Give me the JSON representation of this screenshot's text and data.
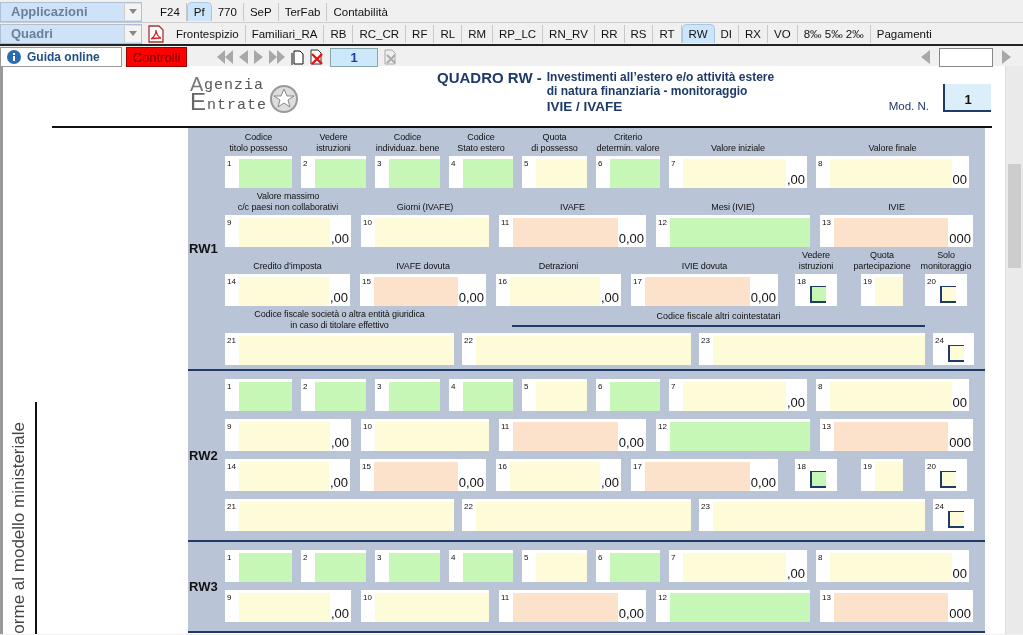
{
  "app_menu": {
    "label": "Applicazioni"
  },
  "app_tabs": [
    {
      "label": "F24",
      "selected": false
    },
    {
      "label": "Pf",
      "selected": true
    },
    {
      "label": "770",
      "selected": false
    },
    {
      "label": "SeP",
      "selected": false
    },
    {
      "label": "TerFab",
      "selected": false
    },
    {
      "label": "Contabilità",
      "selected": false
    }
  ],
  "section_menu": {
    "label": "Quadri"
  },
  "section_tabs": [
    {
      "label": "Frontespizio",
      "selected": false
    },
    {
      "label": "Familiari_RA",
      "selected": false
    },
    {
      "label": "RB",
      "selected": false
    },
    {
      "label": "RC_CR",
      "selected": false
    },
    {
      "label": "RF",
      "selected": false
    },
    {
      "label": "RL",
      "selected": false
    },
    {
      "label": "RM",
      "selected": false
    },
    {
      "label": "RP_LC",
      "selected": false
    },
    {
      "label": "RN_RV",
      "selected": false
    },
    {
      "label": "RR",
      "selected": false
    },
    {
      "label": "RS",
      "selected": false
    },
    {
      "label": "RT",
      "selected": false
    },
    {
      "label": "RW",
      "selected": true
    },
    {
      "label": "DI",
      "selected": false
    },
    {
      "label": "RX",
      "selected": false
    },
    {
      "label": "VO",
      "selected": false
    },
    {
      "label": "8‰ 5‰ 2‰",
      "selected": false
    },
    {
      "label": "Pagamenti",
      "selected": false
    }
  ],
  "toolbar": {
    "help_button": "Guida online",
    "checks_button": "Controlli",
    "page_field": "1"
  },
  "side_note": "orme al modello ministeriale",
  "header": {
    "logo": {
      "initial_top": "A",
      "text_top": "genzia",
      "initial_bottom": "E",
      "text_bottom": "ntrate"
    },
    "title": "QUADRO RW -",
    "subtitle_lines": [
      "Investimenti all’estero e/o attività estere",
      "di natura finanziaria - monitoraggio",
      "IVIE / IVAFE"
    ],
    "mod_label": "Mod. N.",
    "mod_value": "1"
  },
  "sections": [
    {
      "label": "RW1",
      "rows": [
        {
          "kind": "codes",
          "fields": [
            {
              "number": "1",
              "label": "Codice\ntitolo possesso",
              "kind": "input",
              "color": "#c6f7b6"
            },
            {
              "number": "2",
              "label": "Vedere\nistruzioni",
              "kind": "input",
              "color": "#c6f7b6"
            },
            {
              "number": "3",
              "label": "Codice\nindividuaz. bene",
              "kind": "input",
              "color": "#c6f7b6"
            },
            {
              "number": "4",
              "label": "Codice\nStato estero",
              "kind": "input",
              "color": "#c6f7b6"
            },
            {
              "number": "5",
              "label": "Quota\ndi possesso",
              "kind": "input",
              "color": "#fefbd9"
            },
            {
              "number": "6",
              "label": "Criterio\ndetermin. valore",
              "kind": "input",
              "color": "#c6f7b6"
            },
            {
              "number": "7",
              "label": "Valore iniziale",
              "kind": "input",
              "color": "#fefbd9",
              "suffix": ",00"
            },
            {
              "number": "8",
              "label": "Valore finale",
              "kind": "input",
              "color": "#fefbd9",
              "suffix": "00"
            }
          ]
        },
        {
          "kind": "values",
          "fields": [
            {
              "number": "9",
              "label": "Valore massimo\nc/c paesi non collaborativi",
              "kind": "input",
              "color": "#fefbd9",
              "suffix": ",00"
            },
            {
              "number": "10",
              "label": "Giorni (IVAFE)",
              "kind": "input",
              "color": "#fefbd9"
            },
            {
              "number": "11",
              "label": "IVAFE",
              "kind": "input",
              "color": "#fde2cb",
              "suffix": "0,00"
            },
            {
              "number": "12",
              "label": "Mesi (IVIE)",
              "kind": "input",
              "color": "#c6f7b6"
            },
            {
              "number": "13",
              "label": "IVIE",
              "kind": "input",
              "color": "#fde2cb",
              "suffix": "000"
            }
          ]
        },
        {
          "kind": "credits",
          "fields": [
            {
              "number": "14",
              "label": "Credito d’imposta",
              "kind": "input",
              "color": "#fefbd9",
              "suffix": ",00"
            },
            {
              "number": "15",
              "label": "IVAFE dovuta",
              "kind": "input",
              "color": "#fde2cb",
              "suffix": "0,00"
            },
            {
              "number": "16",
              "label": "Detrazioni",
              "kind": "input",
              "color": "#fefbd9",
              "suffix": ",00"
            },
            {
              "number": "17",
              "label": "IVIE dovuta",
              "kind": "input",
              "color": "#fde2cb",
              "suffix": "0,00"
            },
            {
              "number": "18",
              "label": "Vedere\nistruzioni",
              "kind": "check",
              "color": "#c6f7b6",
              "checked": false
            },
            {
              "number": "19",
              "label": "Quota\npartecipazione",
              "kind": "input",
              "color": "#fefbd9"
            },
            {
              "number": "20",
              "label": "Solo\nmonitoraggio",
              "kind": "check",
              "color": "#fefbd9",
              "checked": false
            }
          ]
        },
        {
          "kind": "fiscal",
          "group_heading": "Codice fiscale altri cointestatari",
          "fields": [
            {
              "number": "21",
              "label": "Codice fiscale società o altra entità giuridica\nin caso di titolare effettivo",
              "kind": "input",
              "color": "#fefbd9"
            },
            {
              "number": "22",
              "kind": "input",
              "color": "#fefbd9"
            },
            {
              "number": "23",
              "kind": "input",
              "color": "#fefbd9"
            },
            {
              "number": "24",
              "kind": "check",
              "color": "#fefbd9",
              "checked": false
            }
          ]
        }
      ]
    },
    {
      "label": "RW2",
      "rows": [
        {
          "kind": "codes",
          "fields": [
            {
              "number": "1",
              "kind": "input",
              "color": "#c6f7b6"
            },
            {
              "number": "2",
              "kind": "input",
              "color": "#c6f7b6"
            },
            {
              "number": "3",
              "kind": "input",
              "color": "#c6f7b6"
            },
            {
              "number": "4",
              "kind": "input",
              "color": "#c6f7b6"
            },
            {
              "number": "5",
              "kind": "input",
              "color": "#fefbd9"
            },
            {
              "number": "6",
              "kind": "input",
              "color": "#c6f7b6"
            },
            {
              "number": "7",
              "kind": "input",
              "color": "#fefbd9",
              "suffix": ",00"
            },
            {
              "number": "8",
              "kind": "input",
              "color": "#fefbd9",
              "suffix": "00"
            }
          ]
        },
        {
          "kind": "values",
          "fields": [
            {
              "number": "9",
              "kind": "input",
              "color": "#fefbd9",
              "suffix": ",00"
            },
            {
              "number": "10",
              "kind": "input",
              "color": "#fefbd9"
            },
            {
              "number": "11",
              "kind": "input",
              "color": "#fde2cb",
              "suffix": "0,00"
            },
            {
              "number": "12",
              "kind": "input",
              "color": "#c6f7b6"
            },
            {
              "number": "13",
              "kind": "input",
              "color": "#fde2cb",
              "suffix": "000"
            }
          ]
        },
        {
          "kind": "credits",
          "fields": [
            {
              "number": "14",
              "kind": "input",
              "color": "#fefbd9",
              "suffix": ",00"
            },
            {
              "number": "15",
              "kind": "input",
              "color": "#fde2cb",
              "suffix": "0,00"
            },
            {
              "number": "16",
              "kind": "input",
              "color": "#fefbd9",
              "suffix": ",00"
            },
            {
              "number": "17",
              "kind": "input",
              "color": "#fde2cb",
              "suffix": "0,00"
            },
            {
              "number": "18",
              "kind": "check",
              "color": "#c6f7b6",
              "checked": false
            },
            {
              "number": "19",
              "kind": "input",
              "color": "#fefbd9"
            },
            {
              "number": "20",
              "kind": "check",
              "color": "#fefbd9",
              "checked": false
            }
          ]
        },
        {
          "kind": "fiscal",
          "fields": [
            {
              "number": "21",
              "kind": "input",
              "color": "#fefbd9"
            },
            {
              "number": "22",
              "kind": "input",
              "color": "#fefbd9"
            },
            {
              "number": "23",
              "kind": "input",
              "color": "#fefbd9"
            },
            {
              "number": "24",
              "kind": "check",
              "color": "#fefbd9",
              "checked": false
            }
          ]
        }
      ]
    },
    {
      "label": "RW3",
      "rows": [
        {
          "kind": "codes",
          "fields": [
            {
              "number": "1",
              "kind": "input",
              "color": "#c6f7b6"
            },
            {
              "number": "2",
              "kind": "input",
              "color": "#c6f7b6"
            },
            {
              "number": "3",
              "kind": "input",
              "color": "#c6f7b6"
            },
            {
              "number": "4",
              "kind": "input",
              "color": "#c6f7b6"
            },
            {
              "number": "5",
              "kind": "input",
              "color": "#fefbd9"
            },
            {
              "number": "6",
              "kind": "input",
              "color": "#c6f7b6"
            },
            {
              "number": "7",
              "kind": "input",
              "color": "#fefbd9",
              "suffix": ",00"
            },
            {
              "number": "8",
              "kind": "input",
              "color": "#fefbd9",
              "suffix": "00"
            }
          ]
        },
        {
          "kind": "values",
          "fields": [
            {
              "number": "9",
              "kind": "input",
              "color": "#fefbd9",
              "suffix": ",00"
            },
            {
              "number": "10",
              "kind": "input",
              "color": "#fefbd9"
            },
            {
              "number": "11",
              "kind": "input",
              "color": "#fde2cb",
              "suffix": "0,00"
            },
            {
              "number": "12",
              "kind": "input",
              "color": "#c6f7b6"
            },
            {
              "number": "13",
              "kind": "input",
              "color": "#fde2cb",
              "suffix": "000"
            }
          ]
        }
      ]
    }
  ]
}
